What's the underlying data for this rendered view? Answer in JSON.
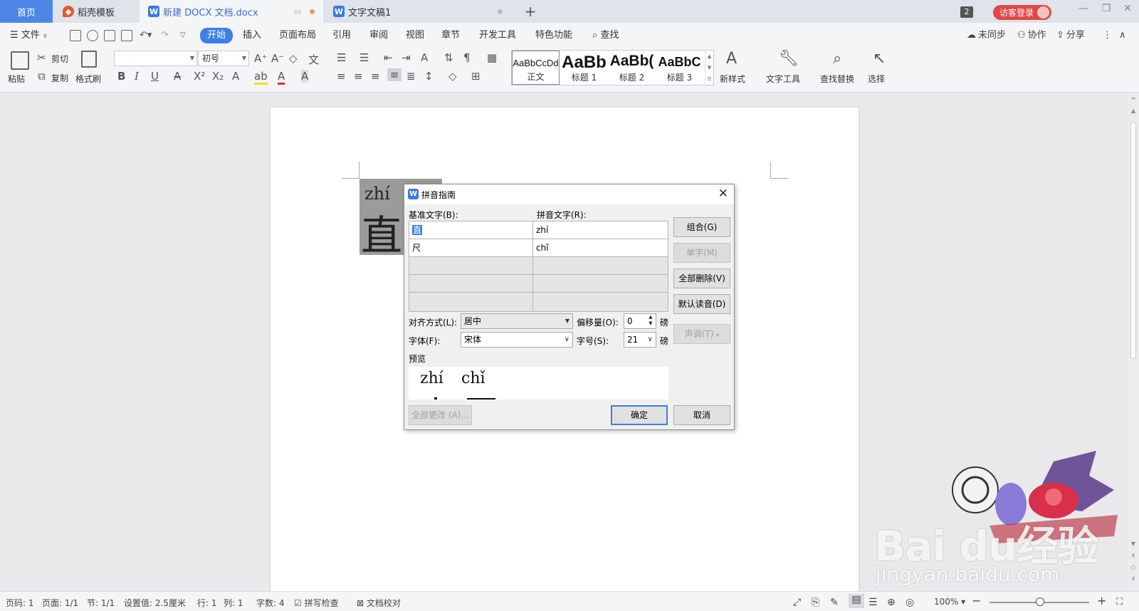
{
  "tabs": {
    "home": "首页",
    "template": "稻壳模板",
    "doc1": "新建 DOCX 文档.docx",
    "doc2": "文字文稿1",
    "window_count": "2",
    "login": "访客登录"
  },
  "menu": {
    "file": "文件",
    "items": [
      "开始",
      "插入",
      "页面布局",
      "引用",
      "审阅",
      "视图",
      "章节",
      "开发工具",
      "特色功能"
    ],
    "search": "查找",
    "unsync": "未同步",
    "collab": "协作",
    "share": "分享"
  },
  "ribbon": {
    "paste": "粘贴",
    "cut": "剪切",
    "copy": "复制",
    "format_painter": "格式刷",
    "font_name": "",
    "font_size": "初号",
    "styles": [
      {
        "sample": "AaBbCcDd",
        "name": "正文"
      },
      {
        "sample": "AaBb",
        "name": "标题 1"
      },
      {
        "sample": "AaBb(",
        "name": "标题 2"
      },
      {
        "sample": "AaBbC",
        "name": "标题 3"
      }
    ],
    "new_style": "新样式",
    "text_tools": "文字工具",
    "find_replace": "查找替换",
    "select": "选择"
  },
  "document": {
    "ruby_text": "zhí",
    "base_text": "直"
  },
  "dialog": {
    "title": "拼音指南",
    "base_label": "基准文字(B):",
    "ruby_label": "拼音文字(R):",
    "rows": [
      {
        "base": "直",
        "ruby": "zhí"
      },
      {
        "base": "尺",
        "ruby": "chǐ"
      },
      {
        "base": "",
        "ruby": ""
      },
      {
        "base": "",
        "ruby": ""
      },
      {
        "base": "",
        "ruby": ""
      }
    ],
    "buttons": {
      "group": "组合(G)",
      "single": "单字(M)",
      "clear_all": "全部删除(V)",
      "default_reading": "默认读音(D)",
      "tone": "声调(T)",
      "change_all": "全部更改 (A)...",
      "ok": "确定",
      "cancel": "取消"
    },
    "align_label": "对齐方式(L):",
    "align_value": "居中",
    "offset_label": "偏移量(O):",
    "offset_value": "0",
    "offset_unit": "磅",
    "font_label": "字体(F):",
    "font_value": "宋体",
    "size_label": "字号(S):",
    "size_value": "21",
    "size_unit": "磅",
    "preview_label": "预览",
    "preview_ruby": [
      "zhí",
      "chǐ"
    ]
  },
  "status": {
    "page": "页码: 1",
    "pages": "页面: 1/1",
    "section": "节: 1/1",
    "setting": "设置值: 2.5厘米",
    "row": "行: 1",
    "col": "列: 1",
    "words": "字数: 4",
    "spell_check": "拼写检查",
    "doc_proof": "文档校对",
    "zoom": "100%"
  },
  "watermark": {
    "brand": "Bai du经验",
    "url": "jingyan.baidu.com"
  },
  "colors": {
    "accent": "#3d7ee8",
    "login": "#e04848",
    "tab_home": "#4d86e6",
    "selection_grey": "#9b9b9b"
  }
}
